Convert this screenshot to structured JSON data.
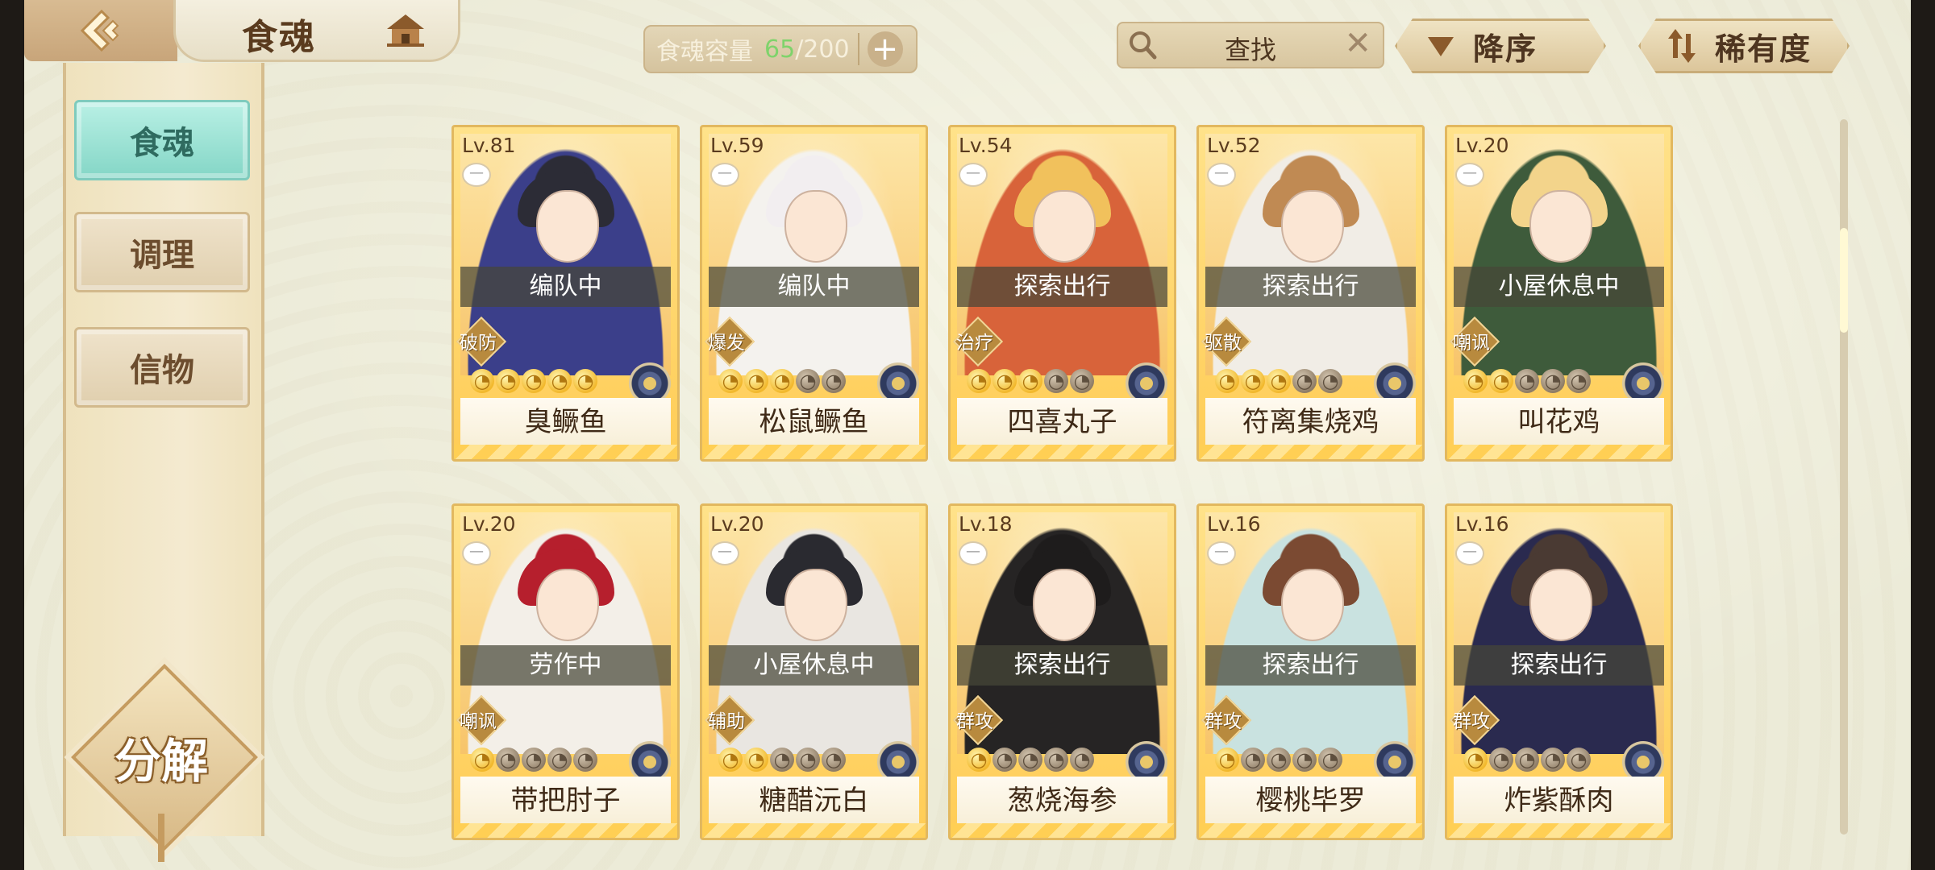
{
  "header": {
    "title": "食魂",
    "capacity": {
      "label": "食魂容量",
      "current": "65",
      "max": "/200"
    },
    "search": {
      "text": "查找"
    },
    "sort_button": "降序",
    "rarity_button": "稀有度"
  },
  "sidebar": {
    "items": [
      {
        "label": "食魂",
        "active": true
      },
      {
        "label": "调理",
        "active": false
      },
      {
        "label": "信物",
        "active": false
      }
    ],
    "decompose_label": "分解"
  },
  "cards": [
    {
      "level": "Lv.81",
      "status": "编队中",
      "role": "破防",
      "name": "臭鳜鱼",
      "stars": 5,
      "max_stars": 5,
      "hair": "#2c2c36",
      "cloth": "#3b3f8a"
    },
    {
      "level": "Lv.59",
      "status": "编队中",
      "role": "爆发",
      "name": "松鼠鳜鱼",
      "stars": 3,
      "max_stars": 5,
      "hair": "#f2eef0",
      "cloth": "#f4f2ee"
    },
    {
      "level": "Lv.54",
      "status": "探索出行",
      "role": "治疗",
      "name": "四喜丸子",
      "stars": 3,
      "max_stars": 5,
      "hair": "#f1c15c",
      "cloth": "#d8633a"
    },
    {
      "level": "Lv.52",
      "status": "探索出行",
      "role": "驱散",
      "name": "符离集烧鸡",
      "stars": 3,
      "max_stars": 5,
      "hair": "#c08a53",
      "cloth": "#f1ede6"
    },
    {
      "level": "Lv.20",
      "status": "小屋休息中",
      "role": "嘲讽",
      "name": "叫花鸡",
      "stars": 2,
      "max_stars": 5,
      "hair": "#f3d48b",
      "cloth": "#3e5b3b"
    },
    {
      "level": "Lv.20",
      "status": "劳作中",
      "role": "嘲讽",
      "name": "带把肘子",
      "stars": 1,
      "max_stars": 5,
      "hair": "#b61f2d",
      "cloth": "#f3efe8"
    },
    {
      "level": "Lv.20",
      "status": "小屋休息中",
      "role": "辅助",
      "name": "糖醋沅白",
      "stars": 2,
      "max_stars": 5,
      "hair": "#2a2a30",
      "cloth": "#e9e6e1"
    },
    {
      "level": "Lv.18",
      "status": "探索出行",
      "role": "群攻",
      "name": "葱烧海参",
      "stars": 1,
      "max_stars": 5,
      "hair": "#1e1c1c",
      "cloth": "#262424"
    },
    {
      "level": "Lv.16",
      "status": "探索出行",
      "role": "群攻",
      "name": "樱桃毕罗",
      "stars": 1,
      "max_stars": 5,
      "hair": "#7b4a32",
      "cloth": "#c9e2e0"
    },
    {
      "level": "Lv.16",
      "status": "探索出行",
      "role": "群攻",
      "name": "炸紫酥肉",
      "stars": 1,
      "max_stars": 5,
      "hair": "#4a3a33",
      "cloth": "#2a2a4f"
    }
  ]
}
